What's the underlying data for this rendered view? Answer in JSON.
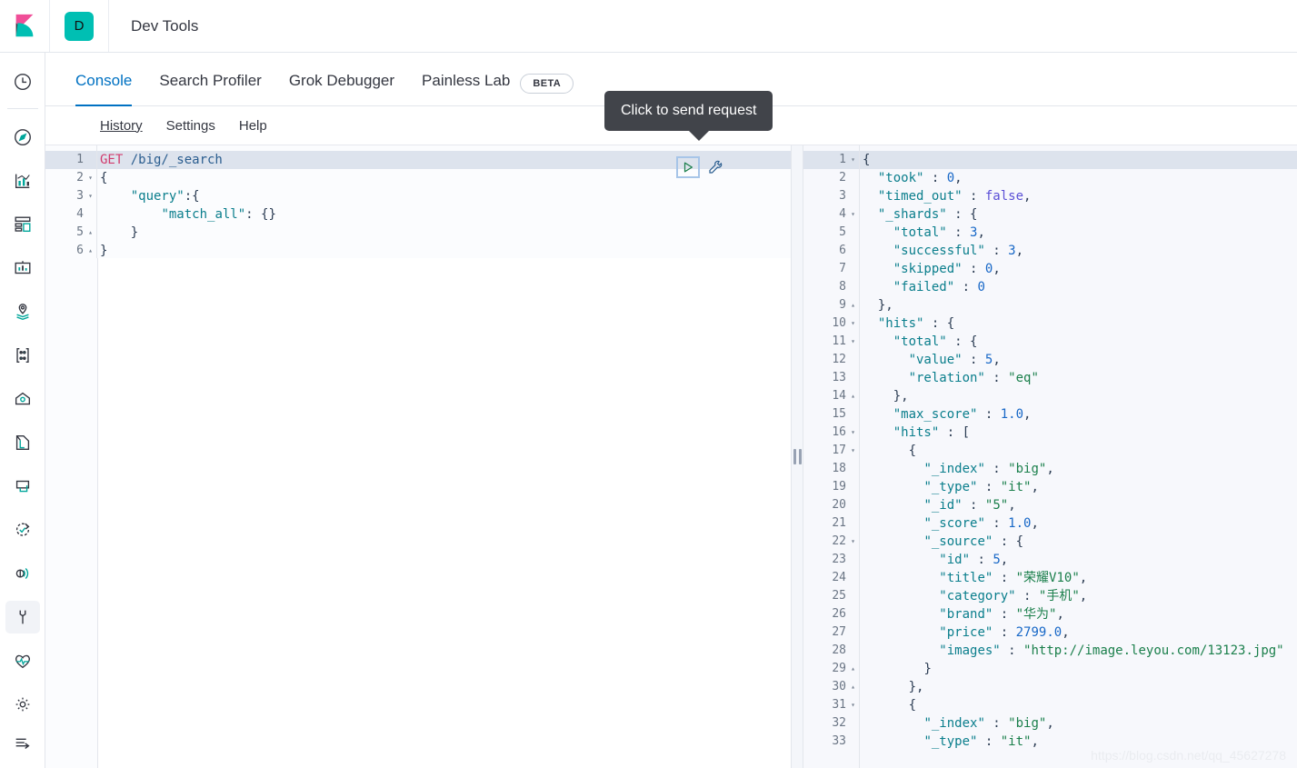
{
  "app": {
    "logo_icon": "kibana-logo",
    "space_badge": "D",
    "title": "Dev Tools",
    "accent_color": "#0071c2",
    "space_color": "#00bfb3"
  },
  "sidebar": {
    "items": [
      {
        "name": "recently-viewed",
        "icon": "clock-icon"
      },
      {
        "name": "discover",
        "icon": "compass-icon"
      },
      {
        "name": "visualize",
        "icon": "bar-chart-icon"
      },
      {
        "name": "dashboard",
        "icon": "dashboard-icon"
      },
      {
        "name": "canvas",
        "icon": "canvas-icon"
      },
      {
        "name": "maps",
        "icon": "map-pin-layers-icon"
      },
      {
        "name": "machine-learning",
        "icon": "machine-learning-icon"
      },
      {
        "name": "infrastructure",
        "icon": "infrastructure-icon"
      },
      {
        "name": "logs",
        "icon": "logs-icon"
      },
      {
        "name": "apm",
        "icon": "apm-icon"
      },
      {
        "name": "uptime",
        "icon": "uptime-icon"
      },
      {
        "name": "siem",
        "icon": "siem-icon"
      },
      {
        "name": "dev-tools",
        "icon": "wrench-icon",
        "active": true
      },
      {
        "name": "monitoring",
        "icon": "heart-pulse-icon"
      },
      {
        "name": "management",
        "icon": "gear-icon"
      }
    ],
    "collapse": {
      "name": "collapse-nav",
      "icon": "arrow-collapse-icon"
    }
  },
  "tabs": [
    {
      "label": "Console",
      "active": true
    },
    {
      "label": "Search Profiler",
      "active": false
    },
    {
      "label": "Grok Debugger",
      "active": false
    },
    {
      "label": "Painless Lab",
      "active": false,
      "badge": "BETA"
    }
  ],
  "submenu": [
    {
      "label": "History",
      "hovered": true
    },
    {
      "label": "Settings",
      "hovered": false
    },
    {
      "label": "Help",
      "hovered": false
    }
  ],
  "tooltip": {
    "text": "Click to send request"
  },
  "actions": {
    "play": {
      "label": "send-request",
      "icon": "play-triangle-icon"
    },
    "wrench": {
      "label": "open-documentation",
      "icon": "wrench-icon"
    }
  },
  "request_editor": {
    "active_line": 1,
    "lines": [
      {
        "n": 1,
        "fold": "",
        "tokens": [
          {
            "t": "GET ",
            "c": "t-method"
          },
          {
            "t": "/big/_search",
            "c": "t-url"
          }
        ]
      },
      {
        "n": 2,
        "fold": "down",
        "tokens": [
          {
            "t": "{",
            "c": "t-punc"
          }
        ]
      },
      {
        "n": 3,
        "fold": "down",
        "tokens": [
          {
            "t": "    ",
            "c": "t-plain"
          },
          {
            "t": "\"query\"",
            "c": "t-key"
          },
          {
            "t": ":{",
            "c": "t-punc"
          }
        ]
      },
      {
        "n": 4,
        "fold": "",
        "tokens": [
          {
            "t": "        ",
            "c": "t-plain"
          },
          {
            "t": "\"match_all\"",
            "c": "t-key"
          },
          {
            "t": ": {}",
            "c": "t-punc"
          }
        ]
      },
      {
        "n": 5,
        "fold": "up",
        "tokens": [
          {
            "t": "    ",
            "c": "t-plain"
          },
          {
            "t": "}",
            "c": "t-punc"
          }
        ]
      },
      {
        "n": 6,
        "fold": "up",
        "tokens": [
          {
            "t": "}",
            "c": "t-punc"
          }
        ]
      }
    ]
  },
  "response_editor": {
    "active_line": 1,
    "lines": [
      {
        "n": 1,
        "fold": "down",
        "tokens": [
          {
            "t": "{",
            "c": "t-punc"
          }
        ]
      },
      {
        "n": 2,
        "fold": "",
        "tokens": [
          {
            "t": "  ",
            "c": "t-plain"
          },
          {
            "t": "\"took\"",
            "c": "t-key"
          },
          {
            "t": " : ",
            "c": "t-punc"
          },
          {
            "t": "0",
            "c": "t-num"
          },
          {
            "t": ",",
            "c": "t-punc"
          }
        ]
      },
      {
        "n": 3,
        "fold": "",
        "tokens": [
          {
            "t": "  ",
            "c": "t-plain"
          },
          {
            "t": "\"timed_out\"",
            "c": "t-key"
          },
          {
            "t": " : ",
            "c": "t-punc"
          },
          {
            "t": "false",
            "c": "t-bool"
          },
          {
            "t": ",",
            "c": "t-punc"
          }
        ]
      },
      {
        "n": 4,
        "fold": "down",
        "tokens": [
          {
            "t": "  ",
            "c": "t-plain"
          },
          {
            "t": "\"_shards\"",
            "c": "t-key"
          },
          {
            "t": " : {",
            "c": "t-punc"
          }
        ]
      },
      {
        "n": 5,
        "fold": "",
        "tokens": [
          {
            "t": "    ",
            "c": "t-plain"
          },
          {
            "t": "\"total\"",
            "c": "t-key"
          },
          {
            "t": " : ",
            "c": "t-punc"
          },
          {
            "t": "3",
            "c": "t-num"
          },
          {
            "t": ",",
            "c": "t-punc"
          }
        ]
      },
      {
        "n": 6,
        "fold": "",
        "tokens": [
          {
            "t": "    ",
            "c": "t-plain"
          },
          {
            "t": "\"successful\"",
            "c": "t-key"
          },
          {
            "t": " : ",
            "c": "t-punc"
          },
          {
            "t": "3",
            "c": "t-num"
          },
          {
            "t": ",",
            "c": "t-punc"
          }
        ]
      },
      {
        "n": 7,
        "fold": "",
        "tokens": [
          {
            "t": "    ",
            "c": "t-plain"
          },
          {
            "t": "\"skipped\"",
            "c": "t-key"
          },
          {
            "t": " : ",
            "c": "t-punc"
          },
          {
            "t": "0",
            "c": "t-num"
          },
          {
            "t": ",",
            "c": "t-punc"
          }
        ]
      },
      {
        "n": 8,
        "fold": "",
        "tokens": [
          {
            "t": "    ",
            "c": "t-plain"
          },
          {
            "t": "\"failed\"",
            "c": "t-key"
          },
          {
            "t": " : ",
            "c": "t-punc"
          },
          {
            "t": "0",
            "c": "t-num"
          }
        ]
      },
      {
        "n": 9,
        "fold": "up",
        "tokens": [
          {
            "t": "  ",
            "c": "t-plain"
          },
          {
            "t": "},",
            "c": "t-punc"
          }
        ]
      },
      {
        "n": 10,
        "fold": "down",
        "tokens": [
          {
            "t": "  ",
            "c": "t-plain"
          },
          {
            "t": "\"hits\"",
            "c": "t-key"
          },
          {
            "t": " : {",
            "c": "t-punc"
          }
        ]
      },
      {
        "n": 11,
        "fold": "down",
        "tokens": [
          {
            "t": "    ",
            "c": "t-plain"
          },
          {
            "t": "\"total\"",
            "c": "t-key"
          },
          {
            "t": " : {",
            "c": "t-punc"
          }
        ]
      },
      {
        "n": 12,
        "fold": "",
        "tokens": [
          {
            "t": "      ",
            "c": "t-plain"
          },
          {
            "t": "\"value\"",
            "c": "t-key"
          },
          {
            "t": " : ",
            "c": "t-punc"
          },
          {
            "t": "5",
            "c": "t-num"
          },
          {
            "t": ",",
            "c": "t-punc"
          }
        ]
      },
      {
        "n": 13,
        "fold": "",
        "tokens": [
          {
            "t": "      ",
            "c": "t-plain"
          },
          {
            "t": "\"relation\"",
            "c": "t-key"
          },
          {
            "t": " : ",
            "c": "t-punc"
          },
          {
            "t": "\"eq\"",
            "c": "t-str"
          }
        ]
      },
      {
        "n": 14,
        "fold": "up",
        "tokens": [
          {
            "t": "    ",
            "c": "t-plain"
          },
          {
            "t": "},",
            "c": "t-punc"
          }
        ]
      },
      {
        "n": 15,
        "fold": "",
        "tokens": [
          {
            "t": "    ",
            "c": "t-plain"
          },
          {
            "t": "\"max_score\"",
            "c": "t-key"
          },
          {
            "t": " : ",
            "c": "t-punc"
          },
          {
            "t": "1.0",
            "c": "t-num"
          },
          {
            "t": ",",
            "c": "t-punc"
          }
        ]
      },
      {
        "n": 16,
        "fold": "down",
        "tokens": [
          {
            "t": "    ",
            "c": "t-plain"
          },
          {
            "t": "\"hits\"",
            "c": "t-key"
          },
          {
            "t": " : [",
            "c": "t-punc"
          }
        ]
      },
      {
        "n": 17,
        "fold": "down",
        "tokens": [
          {
            "t": "      ",
            "c": "t-plain"
          },
          {
            "t": "{",
            "c": "t-punc"
          }
        ]
      },
      {
        "n": 18,
        "fold": "",
        "tokens": [
          {
            "t": "        ",
            "c": "t-plain"
          },
          {
            "t": "\"_index\"",
            "c": "t-key"
          },
          {
            "t": " : ",
            "c": "t-punc"
          },
          {
            "t": "\"big\"",
            "c": "t-str"
          },
          {
            "t": ",",
            "c": "t-punc"
          }
        ]
      },
      {
        "n": 19,
        "fold": "",
        "tokens": [
          {
            "t": "        ",
            "c": "t-plain"
          },
          {
            "t": "\"_type\"",
            "c": "t-key"
          },
          {
            "t": " : ",
            "c": "t-punc"
          },
          {
            "t": "\"it\"",
            "c": "t-str"
          },
          {
            "t": ",",
            "c": "t-punc"
          }
        ]
      },
      {
        "n": 20,
        "fold": "",
        "tokens": [
          {
            "t": "        ",
            "c": "t-plain"
          },
          {
            "t": "\"_id\"",
            "c": "t-key"
          },
          {
            "t": " : ",
            "c": "t-punc"
          },
          {
            "t": "\"5\"",
            "c": "t-str"
          },
          {
            "t": ",",
            "c": "t-punc"
          }
        ]
      },
      {
        "n": 21,
        "fold": "",
        "tokens": [
          {
            "t": "        ",
            "c": "t-plain"
          },
          {
            "t": "\"_score\"",
            "c": "t-key"
          },
          {
            "t": " : ",
            "c": "t-punc"
          },
          {
            "t": "1.0",
            "c": "t-num"
          },
          {
            "t": ",",
            "c": "t-punc"
          }
        ]
      },
      {
        "n": 22,
        "fold": "down",
        "tokens": [
          {
            "t": "        ",
            "c": "t-plain"
          },
          {
            "t": "\"_source\"",
            "c": "t-key"
          },
          {
            "t": " : {",
            "c": "t-punc"
          }
        ]
      },
      {
        "n": 23,
        "fold": "",
        "tokens": [
          {
            "t": "          ",
            "c": "t-plain"
          },
          {
            "t": "\"id\"",
            "c": "t-key"
          },
          {
            "t": " : ",
            "c": "t-punc"
          },
          {
            "t": "5",
            "c": "t-num"
          },
          {
            "t": ",",
            "c": "t-punc"
          }
        ]
      },
      {
        "n": 24,
        "fold": "",
        "tokens": [
          {
            "t": "          ",
            "c": "t-plain"
          },
          {
            "t": "\"title\"",
            "c": "t-key"
          },
          {
            "t": " : ",
            "c": "t-punc"
          },
          {
            "t": "\"荣耀V10\"",
            "c": "t-str"
          },
          {
            "t": ",",
            "c": "t-punc"
          }
        ]
      },
      {
        "n": 25,
        "fold": "",
        "tokens": [
          {
            "t": "          ",
            "c": "t-plain"
          },
          {
            "t": "\"category\"",
            "c": "t-key"
          },
          {
            "t": " : ",
            "c": "t-punc"
          },
          {
            "t": "\"手机\"",
            "c": "t-str"
          },
          {
            "t": ",",
            "c": "t-punc"
          }
        ]
      },
      {
        "n": 26,
        "fold": "",
        "tokens": [
          {
            "t": "          ",
            "c": "t-plain"
          },
          {
            "t": "\"brand\"",
            "c": "t-key"
          },
          {
            "t": " : ",
            "c": "t-punc"
          },
          {
            "t": "\"华为\"",
            "c": "t-str"
          },
          {
            "t": ",",
            "c": "t-punc"
          }
        ]
      },
      {
        "n": 27,
        "fold": "",
        "tokens": [
          {
            "t": "          ",
            "c": "t-plain"
          },
          {
            "t": "\"price\"",
            "c": "t-key"
          },
          {
            "t": " : ",
            "c": "t-punc"
          },
          {
            "t": "2799.0",
            "c": "t-num"
          },
          {
            "t": ",",
            "c": "t-punc"
          }
        ]
      },
      {
        "n": 28,
        "fold": "",
        "tokens": [
          {
            "t": "          ",
            "c": "t-plain"
          },
          {
            "t": "\"images\"",
            "c": "t-key"
          },
          {
            "t": " : ",
            "c": "t-punc"
          },
          {
            "t": "\"http://image.leyou.com/13123.jpg\"",
            "c": "t-str"
          }
        ]
      },
      {
        "n": 29,
        "fold": "up",
        "tokens": [
          {
            "t": "        ",
            "c": "t-plain"
          },
          {
            "t": "}",
            "c": "t-punc"
          }
        ]
      },
      {
        "n": 30,
        "fold": "up",
        "tokens": [
          {
            "t": "      ",
            "c": "t-plain"
          },
          {
            "t": "},",
            "c": "t-punc"
          }
        ]
      },
      {
        "n": 31,
        "fold": "down",
        "tokens": [
          {
            "t": "      ",
            "c": "t-plain"
          },
          {
            "t": "{",
            "c": "t-punc"
          }
        ]
      },
      {
        "n": 32,
        "fold": "",
        "tokens": [
          {
            "t": "        ",
            "c": "t-plain"
          },
          {
            "t": "\"_index\"",
            "c": "t-key"
          },
          {
            "t": " : ",
            "c": "t-punc"
          },
          {
            "t": "\"big\"",
            "c": "t-str"
          },
          {
            "t": ",",
            "c": "t-punc"
          }
        ]
      },
      {
        "n": 33,
        "fold": "",
        "tokens": [
          {
            "t": "        ",
            "c": "t-plain"
          },
          {
            "t": "\"_type\"",
            "c": "t-key"
          },
          {
            "t": " : ",
            "c": "t-punc"
          },
          {
            "t": "\"it\"",
            "c": "t-str"
          },
          {
            "t": ",",
            "c": "t-punc"
          }
        ]
      }
    ]
  },
  "watermark": {
    "text": "https://blog.csdn.net/qq_45627278"
  }
}
